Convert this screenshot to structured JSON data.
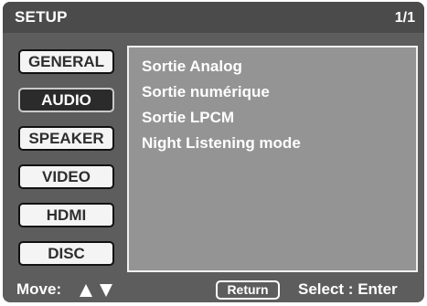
{
  "header": {
    "title": "SETUP",
    "page_indicator": "1/1"
  },
  "menu": {
    "items": [
      {
        "label": "GENERAL",
        "selected": false
      },
      {
        "label": "AUDIO",
        "selected": true
      },
      {
        "label": "SPEAKER",
        "selected": false
      },
      {
        "label": "VIDEO",
        "selected": false
      },
      {
        "label": "HDMI",
        "selected": false
      },
      {
        "label": "DISC",
        "selected": false
      }
    ]
  },
  "content": {
    "items": [
      "Sortie Analog",
      "Sortie numérique",
      "Sortie LPCM",
      "Night Listening mode"
    ]
  },
  "footer": {
    "move_label": "Move:",
    "up_icon": "arrow-up-icon",
    "down_icon": "arrow-down-icon",
    "return_label": "Return",
    "select_label": "Select : Enter"
  },
  "colors": {
    "screen_background": "#5d5d5d",
    "title_bar": "#4b4b4b",
    "content_panel": "#949494",
    "selected_button": "#2b2b2b",
    "button": "#f4f4f4"
  }
}
